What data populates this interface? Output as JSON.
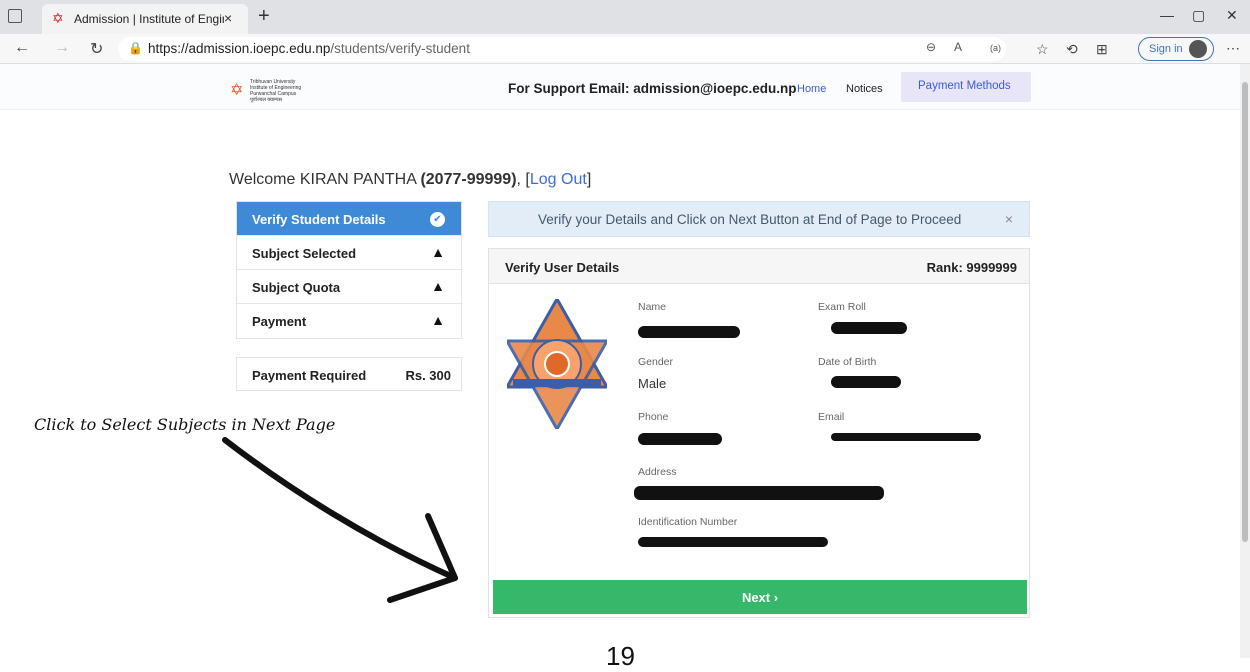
{
  "browser": {
    "tab_title": "Admission | Institute of Engineer",
    "tab_close": "×",
    "new_tab": "+",
    "url_host": "https://admission.ioepc.edu.np",
    "url_path": "/students/verify-student",
    "sign_in": "Sign in",
    "reader_badge": "(a)"
  },
  "site": {
    "logo_lines": [
      "Tribhuvan University",
      "Institute of Engineering",
      "Purwanchal Campus",
      "पूर्वाञ्चल क्याम्पस"
    ],
    "support_text": "For Support Email: admission@ioepc.edu.np",
    "nav": {
      "home": "Home",
      "notices": "Notices",
      "payment_methods": "Payment Methods"
    }
  },
  "welcome": {
    "prefix": "Welcome KIRAN PANTHA ",
    "roll": "(2077-99999)",
    "sep": ", [",
    "logout": "Log Out",
    "close": "]"
  },
  "steps": [
    {
      "label": "Verify Student Details",
      "status": "check"
    },
    {
      "label": "Subject Selected",
      "status": "warning"
    },
    {
      "label": "Subject Quota",
      "status": "warning"
    },
    {
      "label": "Payment",
      "status": "warning"
    }
  ],
  "payment_required": {
    "label": "Payment Required",
    "amount": "Rs. 300"
  },
  "alert": {
    "message": "Verify your Details and Click on Next Button at End of Page to Proceed",
    "close": "×"
  },
  "card": {
    "title": "Verify User Details",
    "rank": "Rank: 9999999",
    "fields": {
      "name": "Name",
      "exam_roll": "Exam Roll",
      "gender": "Gender",
      "gender_value": "Male",
      "dob": "Date of Birth",
      "phone": "Phone",
      "email": "Email",
      "address": "Address",
      "id_number": "Identification Number"
    },
    "next": "Next ›"
  },
  "annotation": "Click to Select Subjects in Next Page",
  "page_number": "19",
  "colors": {
    "active_step": "#3f8ad6",
    "next_button": "#36b86a",
    "alert_bg": "#e2edf8"
  }
}
